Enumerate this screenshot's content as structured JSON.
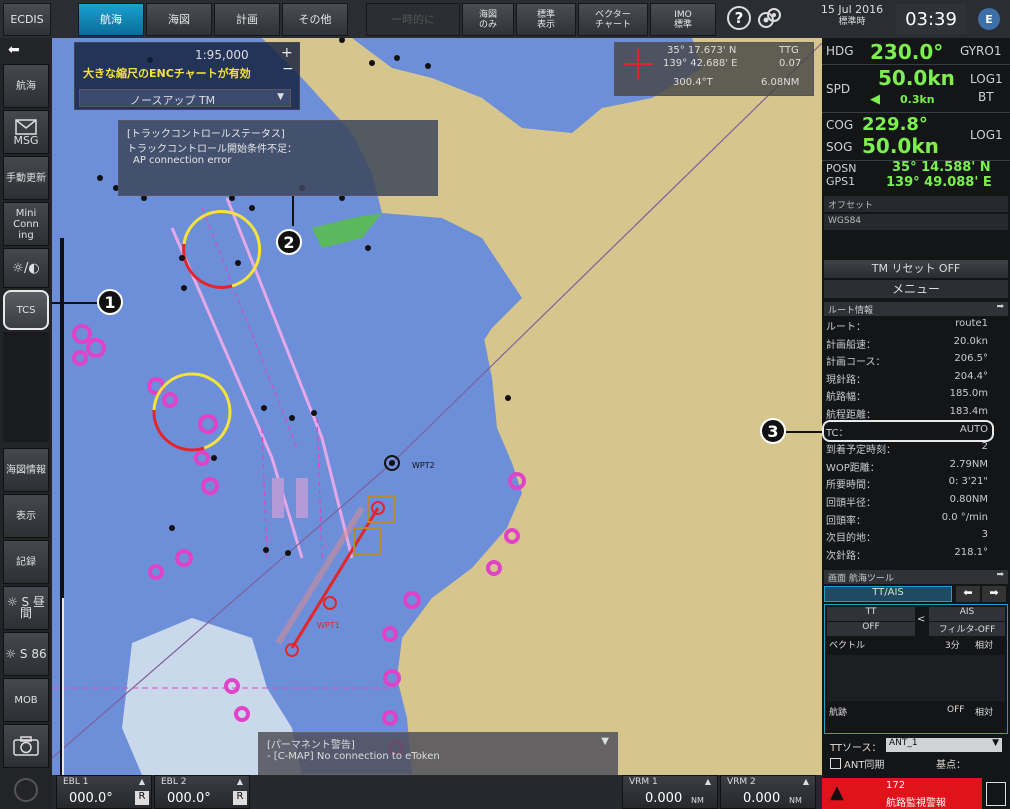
{
  "topbar": {
    "ecdis": "ECDIS",
    "tabs": [
      "航海",
      "海図",
      "計画",
      "その他"
    ],
    "faded_btn": "ー時的に",
    "btn_chart_only": [
      "海図",
      "のみ"
    ],
    "btn_std_display": [
      "標準",
      "表示"
    ],
    "btn_vector_chart": [
      "ベクター",
      "チャート"
    ],
    "btn_imo_std": [
      "IMO",
      "標準"
    ],
    "help": "?",
    "date": "15 Jul 2016",
    "date_sub": "標準時",
    "time": "03:39",
    "user_icon": "E"
  },
  "leftbar": {
    "items": [
      "航海",
      "MSG",
      "手動更新",
      "Mini Conn ing",
      "☼/◐",
      "TCS",
      "海図情報",
      "表示",
      "記録",
      "☼ S 昼間",
      "☼ S 86",
      "MOB",
      "camera"
    ]
  },
  "chart": {
    "scale": "1:95,000",
    "enc_warning": "大きな縮尺のENCチャートが有効",
    "orientation": "ノースアップ TM",
    "cursor_lat": "35° 17.673' N",
    "cursor_lon": "139° 42.688' E",
    "ttg_label": "TTG",
    "ttg_value": "0.07",
    "bearing": "300.4°T",
    "range": "6.08NM",
    "tcs_status_title": "[トラックコントロールステータス]",
    "tcs_status_line2": "トラックコントロール開始条件不足：",
    "tcs_status_line3": "AP connection error",
    "perm_alert_title": "[パーマネント警告]",
    "perm_alert_msg": "- [C-MAP] No connection to eToken",
    "route_label_1": "WPT1",
    "route_label_2": "WPT2"
  },
  "callouts": [
    "1",
    "2",
    "3"
  ],
  "right": {
    "hdg_label": "HDG",
    "hdg_value": "230.0°",
    "hdg_src": "GYRO1",
    "spd_label": "SPD",
    "spd_value": "50.0kn",
    "spd_src": "LOG1",
    "spd_sub": "0.3kn",
    "spd_sub_src": "BT",
    "cog_label": "COG",
    "cog_value": "229.8°",
    "sog_label": "SOG",
    "sog_value": "50.0kn",
    "sog_src": "LOG1",
    "posn_label": "POSN",
    "gps_label": "GPS1",
    "lat": "35° 14.588' N",
    "lon": "139° 49.088' E",
    "offset": "オフセット",
    "datum": "WGS84",
    "tm_reset": "TM リセット OFF",
    "menu": "メニュー",
    "route_info": "ルート情報",
    "route_rows": [
      {
        "k": "ルート：",
        "v": "route1"
      },
      {
        "k": "計画船速：",
        "v": "20.0kn"
      },
      {
        "k": "計画コース：",
        "v": "206.5°"
      },
      {
        "k": "現針路：",
        "v": "204.4°"
      },
      {
        "k": "航路幅：",
        "v": "185.0m"
      },
      {
        "k": "航程距離：",
        "v": "183.4m"
      },
      {
        "k": "TC：",
        "v": "AUTO"
      },
      {
        "k": "到着予定時刻：",
        "v": "2"
      },
      {
        "k": "WOP距離：",
        "v": "2.79NM"
      },
      {
        "k": "所要時間：",
        "v": "0: 3'21\""
      },
      {
        "k": "回頭半径：",
        "v": "0.80NM"
      },
      {
        "k": "回頭率：",
        "v": "0.0 °/min"
      },
      {
        "k": "次目的地：",
        "v": "3"
      },
      {
        "k": "次針路：",
        "v": "218.1°"
      }
    ],
    "tools_title": "画面 航海ツール",
    "tt_ais_tab": "TT/AIS",
    "tt_label": "TT",
    "tt_state": "OFF",
    "ais_label": "AIS",
    "ais_filter": "フィルタ-OFF",
    "lt": "<",
    "vector_label": "ベクトル",
    "vector_time": "3分",
    "vector_mode": "相対",
    "trail_label": "航跡",
    "trail_state": "OFF",
    "trail_mode": "相対",
    "tt_source_label": "TTソース：",
    "tt_source_val": "ANT_1",
    "ant_sync": "ANT同期",
    "base_label": "基点："
  },
  "bottom": {
    "ebl1_label": "EBL 1",
    "ebl1_value": "000.0°",
    "ebl2_label": "EBL 2",
    "ebl2_value": "000.0°",
    "r": "R",
    "vrm1_label": "VRM 1",
    "vrm1_value": "0.000",
    "vrm2_label": "VRM 2",
    "vrm2_value": "0.000",
    "nm": "NM",
    "alarm_num": "172",
    "alarm_text": "航路監視警報"
  },
  "colors": {
    "accent": "#1ba0d2",
    "ok": "#7cf04f",
    "sea": "#6d8fd9",
    "land": "#d6c68e",
    "magenta": "#e043c8",
    "alarm": "#e0121a"
  }
}
